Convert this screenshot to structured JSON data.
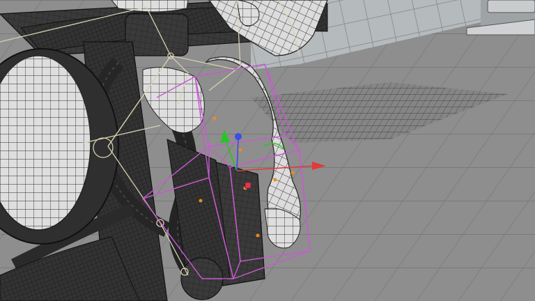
{
  "viewport": {
    "kind": "3d-modeling-viewport",
    "mode": "wireframe-on-shaded",
    "selected_object": "leg-knee-control-cage",
    "gizmo": {
      "type": "move-manipulator",
      "axes": [
        {
          "name": "x",
          "color": "#e23a3a"
        },
        {
          "name": "y",
          "color": "#28c428"
        },
        {
          "name": "z",
          "color": "#3a4ee8"
        }
      ]
    }
  },
  "colors": {
    "floor": "#8e8e8e",
    "floor_lines": "#6a6a6a",
    "wall": "#b5babd",
    "wall_tiles": "#8a9095",
    "mesh_fill": "#d9d9d9",
    "mesh_wire": "#2b2b2b",
    "dark_mesh": "#3b3b3b",
    "cage": "#c85ad2",
    "skeleton": "#d8d0b0",
    "handle": "#f08a1a"
  }
}
